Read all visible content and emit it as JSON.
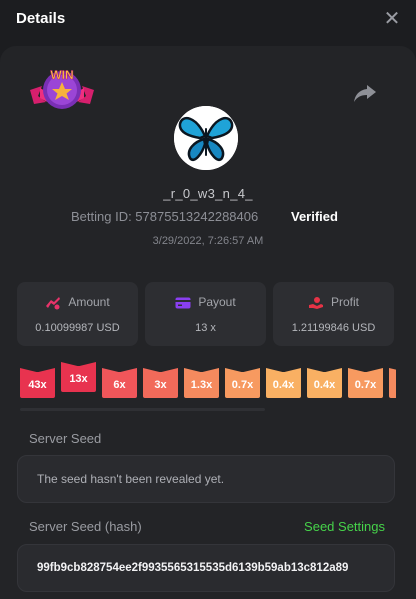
{
  "header": {
    "title": "Details",
    "close_label": "✕"
  },
  "badge": {
    "text": "WIN"
  },
  "user": {
    "username": "_r_0_w3_n_4_",
    "betting_id": "Betting ID: 578755132422884​06",
    "verified": "Verified",
    "datetime": "3/29/2022, 7:26:57 AM"
  },
  "stats": {
    "amount": {
      "label": "Amount",
      "value": "0.10099987 USD"
    },
    "payout": {
      "label": "Payout",
      "value": "13 x"
    },
    "profit": {
      "label": "Profit",
      "value": "1.21199846 USD"
    }
  },
  "multipliers": [
    {
      "label": "43x",
      "color": "#e8334f"
    },
    {
      "label": "13x",
      "color": "#e8334f"
    },
    {
      "label": "6x",
      "color": "#f0565a"
    },
    {
      "label": "3x",
      "color": "#f26a5a"
    },
    {
      "label": "1.3x",
      "color": "#f58a5e"
    },
    {
      "label": "0.7x",
      "color": "#f79a60"
    },
    {
      "label": "0.4x",
      "color": "#f9b063"
    },
    {
      "label": "0.4x",
      "color": "#f9b063"
    },
    {
      "label": "0.7x",
      "color": "#f79a60"
    }
  ],
  "seed": {
    "server_seed_label": "Server Seed",
    "server_seed_value": "The seed hasn't been revealed yet.",
    "server_seed_hash_label": "Server Seed (hash)",
    "seed_settings_label": "Seed Settings",
    "server_seed_hash_value": "99fb9cb828754ee2f9935565315535d6139b59ab13c812a89"
  },
  "colors": {
    "background": "#1c1d20",
    "panel": "#232427",
    "accent_green": "#46d34a"
  }
}
